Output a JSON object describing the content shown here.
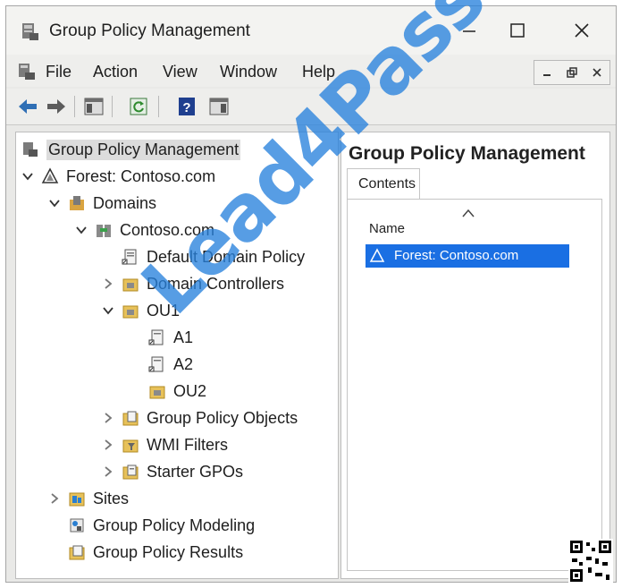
{
  "window": {
    "title": "Group Policy Management"
  },
  "menu": [
    "File",
    "Action",
    "View",
    "Window",
    "Help"
  ],
  "tree": {
    "root": "Group Policy Management",
    "forest": "Forest: Contoso.com",
    "domains": "Domains",
    "domain": "Contoso.com",
    "default_policy": "Default Domain Policy",
    "domain_controllers": "Domain Controllers",
    "ou1": "OU1",
    "a1": "A1",
    "a2": "A2",
    "ou2": "OU2",
    "gpo_objects": "Group Policy Objects",
    "wmi_filters": "WMI Filters",
    "starter_gpos": "Starter GPOs",
    "sites": "Sites",
    "modeling": "Group Policy Modeling",
    "results": "Group Policy Results"
  },
  "right_pane": {
    "title": "Group Policy Management",
    "tab": "Contents",
    "column": "Name",
    "selected_item": "Forest: Contoso.com"
  },
  "watermark": "Lead4Pass.com",
  "colors": {
    "selection": "#1a6fe3",
    "watermark": "#2882dc"
  }
}
